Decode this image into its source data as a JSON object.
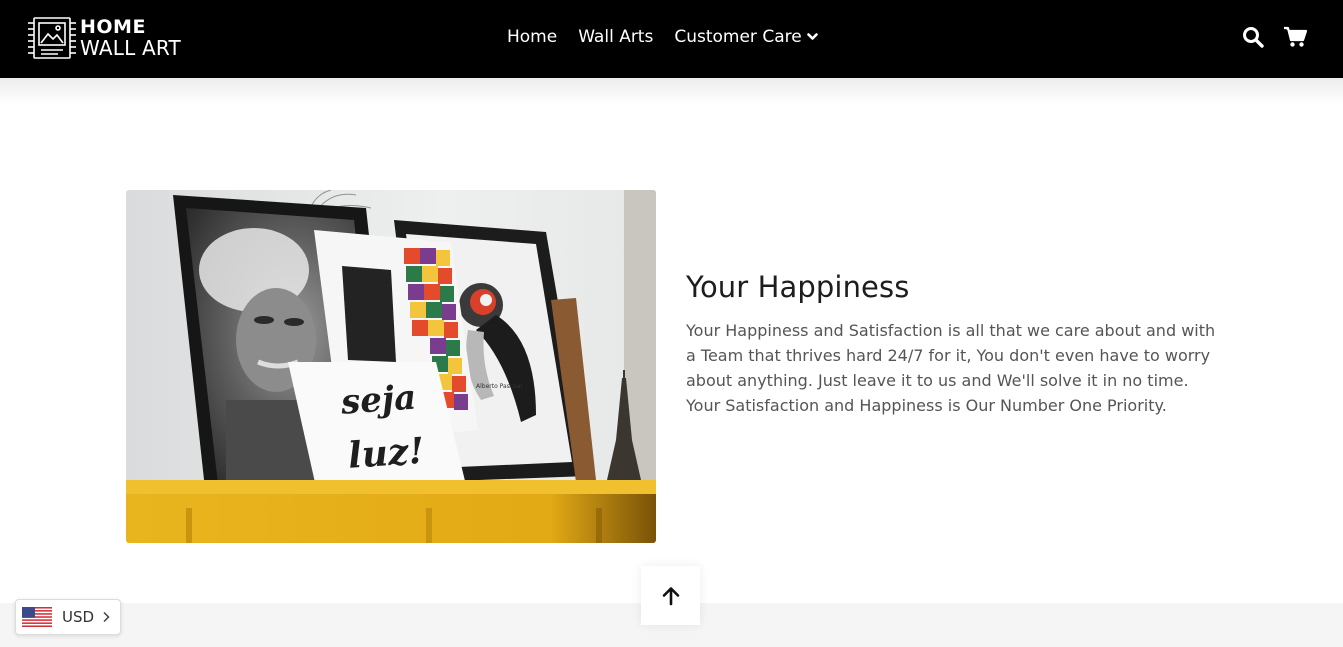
{
  "header": {
    "logo": {
      "line1": "HOME",
      "line2": "WALL ART"
    },
    "nav": [
      {
        "label": "Home"
      },
      {
        "label": "Wall Arts"
      },
      {
        "label": "Customer Care"
      }
    ],
    "icons": [
      "search-icon",
      "cart-icon"
    ]
  },
  "main": {
    "title": "Your Happiness",
    "body": "Your Happiness and Satisfaction is all that we care about and with a Team that thrives hard 24/7 for it, You don't even have to worry about anything. Just leave it to us and We'll solve it in no time. Your Satisfaction and Happiness is Our Number One Priority.",
    "image": {
      "frame_text": "Alberto Pascoal",
      "poster_lines": [
        "seja",
        "luz!"
      ]
    }
  },
  "currency": {
    "code": "USD"
  },
  "colors": {
    "header_bg": "#000000",
    "shelf_yellow": "#e8b31c",
    "footer_band": "#f5f5f5",
    "text": "#555555"
  }
}
